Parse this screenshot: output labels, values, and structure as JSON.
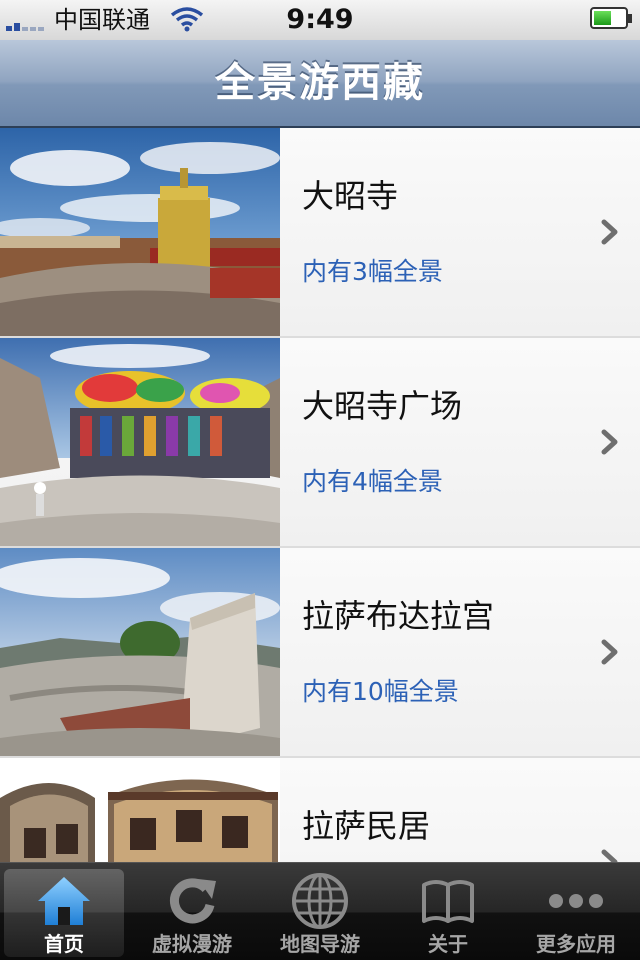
{
  "status_bar": {
    "carrier": "中国联通",
    "time": "9:49"
  },
  "nav": {
    "title": "全景游西藏"
  },
  "list": {
    "items": [
      {
        "title": "大昭寺",
        "subtitle": "内有3幅全景"
      },
      {
        "title": "大昭寺广场",
        "subtitle": "内有4幅全景"
      },
      {
        "title": "拉萨布达拉宫",
        "subtitle": "内有10幅全景"
      },
      {
        "title": "拉萨民居",
        "subtitle": ""
      }
    ]
  },
  "tab_bar": {
    "tabs": [
      {
        "label": "首页",
        "icon": "home-icon",
        "active": true
      },
      {
        "label": "虚拟漫游",
        "icon": "refresh-icon",
        "active": false
      },
      {
        "label": "地图导游",
        "icon": "globe-icon",
        "active": false
      },
      {
        "label": "关于",
        "icon": "book-icon",
        "active": false
      },
      {
        "label": "更多应用",
        "icon": "more-icon",
        "active": false
      }
    ]
  },
  "colors": {
    "nav_bar": "#8199b8",
    "subtitle_link": "#2c61b6",
    "tab_bar": "#1a1a1a",
    "active_tab_icon": "#4aa8ee"
  }
}
